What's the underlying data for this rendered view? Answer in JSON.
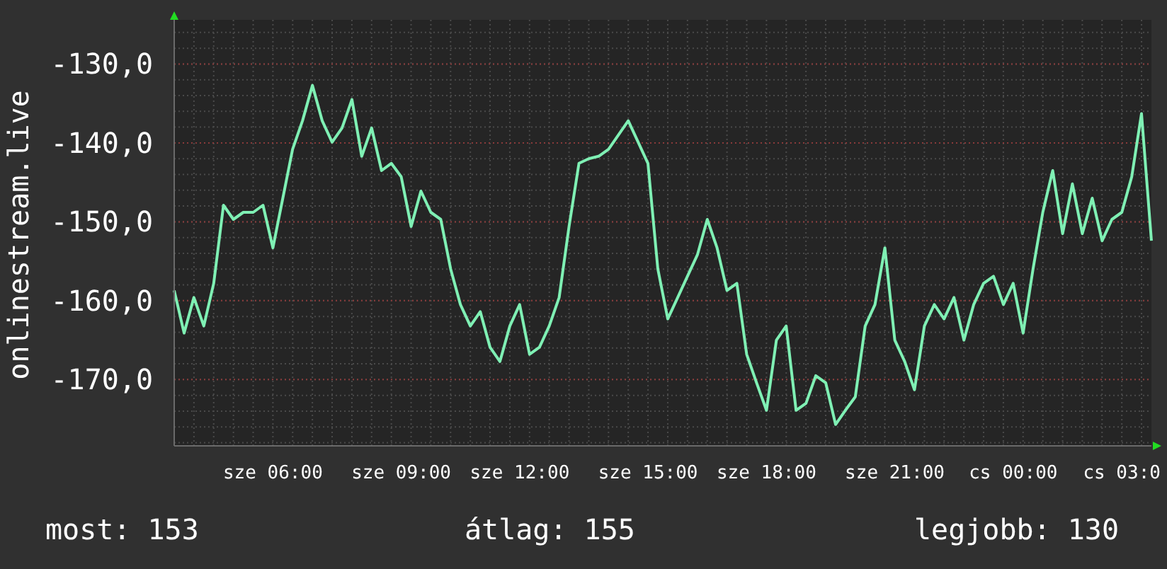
{
  "chart": {
    "chart_data": {
      "type": "line",
      "ylabel": "onlinestream.live",
      "grid": true,
      "ylim": [
        -178.4,
        -124.4
      ],
      "yticks": [
        {
          "value": -130,
          "label": "-130,0"
        },
        {
          "value": -140,
          "label": "-140,0"
        },
        {
          "value": -150,
          "label": "-150,0"
        },
        {
          "value": -160,
          "label": "-160,0"
        },
        {
          "value": -170,
          "label": "-170,0"
        }
      ],
      "categories": [
        null,
        null,
        null,
        null,
        null,
        null,
        null,
        null,
        null,
        null,
        "sze 06:00",
        null,
        null,
        null,
        null,
        null,
        null,
        null,
        null,
        null,
        null,
        null,
        null,
        "sze 09:00",
        null,
        null,
        null,
        null,
        null,
        null,
        null,
        null,
        null,
        null,
        null,
        "sze 12:00",
        null,
        null,
        null,
        null,
        null,
        null,
        null,
        null,
        null,
        null,
        null,
        null,
        "sze 15:00",
        null,
        null,
        null,
        null,
        null,
        null,
        null,
        null,
        null,
        null,
        null,
        "sze 18:00",
        null,
        null,
        null,
        null,
        null,
        null,
        null,
        null,
        null,
        null,
        null,
        null,
        "sze 21:00",
        null,
        null,
        null,
        null,
        null,
        null,
        null,
        null,
        null,
        null,
        null,
        "cs 00:00",
        null,
        null,
        null,
        null,
        null,
        null,
        null,
        null,
        null,
        null,
        "cs 03:0",
        null,
        null,
        null
      ],
      "series": [
        {
          "color": "#7ff0b4",
          "values": [
            -158.7,
            -164.1,
            -159.6,
            -163.2,
            -157.8,
            -147.9,
            -149.7,
            -148.8,
            -148.8,
            -147.9,
            -153.3,
            -147.0,
            -140.8,
            -137.2,
            -132.7,
            -137.2,
            -139.9,
            -138.1,
            -134.5,
            -141.7,
            -138.1,
            -143.5,
            -142.6,
            -144.3,
            -150.6,
            -146.1,
            -148.8,
            -149.7,
            -156.0,
            -160.5,
            -163.2,
            -161.4,
            -165.9,
            -167.7,
            -163.2,
            -160.5,
            -166.8,
            -165.9,
            -163.2,
            -159.6,
            -150.6,
            -142.6,
            -142.0,
            -141.7,
            -140.8,
            -139.0,
            -137.2,
            -139.9,
            -142.6,
            -156.0,
            -162.3,
            -159.6,
            -156.9,
            -154.2,
            -149.7,
            -153.3,
            -158.7,
            -157.8,
            -166.8,
            -170.4,
            -173.9,
            -165.0,
            -163.2,
            -173.9,
            -173.0,
            -169.5,
            -170.4,
            -175.7,
            -173.9,
            -172.2,
            -163.2,
            -160.5,
            -153.3,
            -165.0,
            -167.7,
            -171.3,
            -163.2,
            -160.5,
            -162.3,
            -159.6,
            -165.0,
            -160.5,
            -157.8,
            -156.9,
            -160.5,
            -157.8,
            -164.1,
            -156.0,
            -148.8,
            -143.5,
            -151.5,
            -145.2,
            -151.5,
            -147.0,
            -152.4,
            -149.7,
            -148.8,
            -144.3,
            -136.3,
            -152.4
          ]
        }
      ]
    }
  },
  "stats": [
    "most: 153",
    "átlag: 155",
    "legjobb: 130"
  ]
}
